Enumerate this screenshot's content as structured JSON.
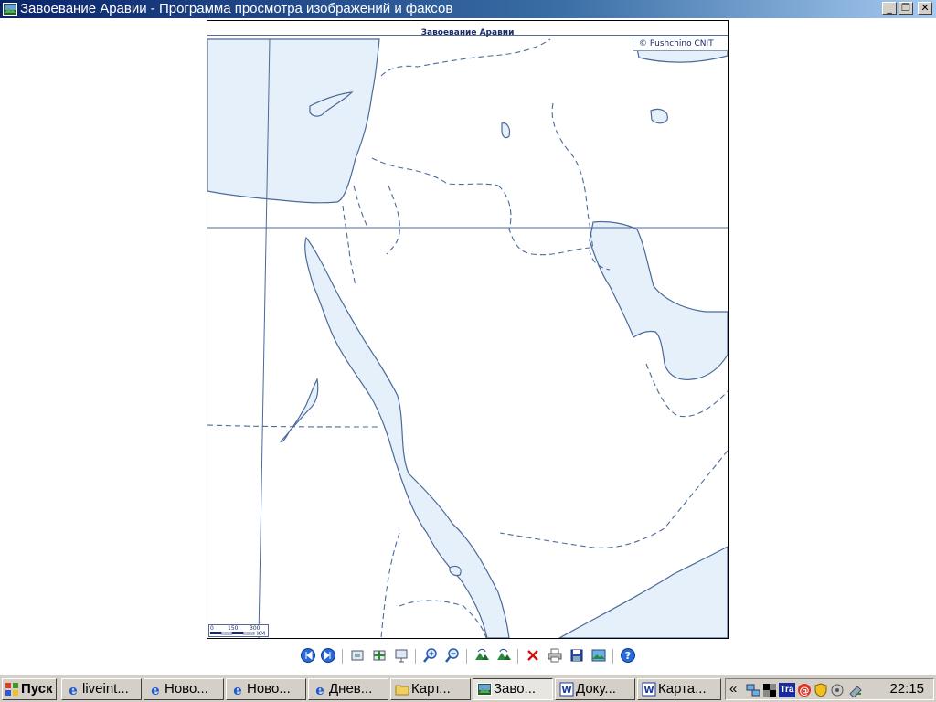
{
  "window": {
    "title": "Завоевание Аравии - Программа просмотра изображений и факсов",
    "minimize": "_",
    "restore": "❐",
    "close": "✕"
  },
  "map": {
    "title": "Завоевание Аравии",
    "copyright": "© Pushchino CNIT",
    "scale": {
      "zero": "0",
      "mid": "150",
      "max": "300",
      "unit": "KM"
    },
    "colors": {
      "water": "#e6f0fb",
      "coast": "#4a6a9a",
      "border": "#4a6a9a",
      "grid": "#4a6a9a"
    }
  },
  "toolbar": {
    "items": [
      {
        "name": "previous-image-button",
        "icon": "prev-icon"
      },
      {
        "name": "next-image-button",
        "icon": "next-icon"
      },
      {
        "name": "best-fit-button",
        "icon": "best-fit-icon"
      },
      {
        "name": "actual-size-button",
        "icon": "actual-size-icon"
      },
      {
        "name": "slideshow-button",
        "icon": "slideshow-icon"
      },
      {
        "name": "zoom-in-button",
        "icon": "zoom-in-icon"
      },
      {
        "name": "zoom-out-button",
        "icon": "zoom-out-icon"
      },
      {
        "name": "rotate-clockwise-button",
        "icon": "rotate-cw-icon"
      },
      {
        "name": "rotate-counterclockwise-button",
        "icon": "rotate-ccw-icon"
      },
      {
        "name": "delete-button",
        "icon": "delete-icon"
      },
      {
        "name": "print-button",
        "icon": "print-icon"
      },
      {
        "name": "save-button",
        "icon": "save-icon"
      },
      {
        "name": "open-for-editing-button",
        "icon": "edit-icon"
      },
      {
        "name": "help-button",
        "icon": "help-icon"
      }
    ]
  },
  "taskbar": {
    "start": "Пуск",
    "tasks": [
      {
        "label": "liveint...",
        "icon": "ie-icon"
      },
      {
        "label": "Ново...",
        "icon": "ie-icon"
      },
      {
        "label": "Ново...",
        "icon": "ie-icon"
      },
      {
        "label": "Днев...",
        "icon": "ie-icon"
      },
      {
        "label": "Карт...",
        "icon": "folder-icon"
      },
      {
        "label": "Заво...",
        "icon": "image-viewer-icon"
      },
      {
        "label": "Доку...",
        "icon": "word-icon"
      },
      {
        "label": "Карта...",
        "icon": "word-icon"
      }
    ],
    "tray": {
      "chevron": "«",
      "app_text": "Tra",
      "clock": "22:15"
    }
  }
}
